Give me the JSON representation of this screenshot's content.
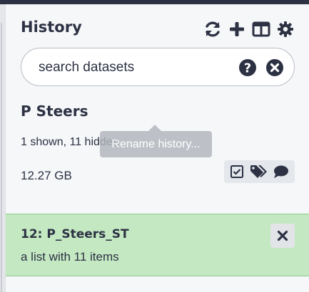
{
  "panel": {
    "title": "History"
  },
  "toolbar": {
    "icons": [
      "sync-icon",
      "plus-icon",
      "columns-icon",
      "gear-icon"
    ]
  },
  "search": {
    "placeholder": "search datasets"
  },
  "history": {
    "name": "P Steers",
    "counts": "1 shown, 11 hidden",
    "tooltip": "Rename history...",
    "size": "12.27 GB"
  },
  "items": [
    {
      "title": "12: P_Steers_ST",
      "subtitle": "a list with 11 items",
      "state_color": "#c4e8c2"
    }
  ],
  "colors": {
    "text": "#2c3143",
    "ok_state": "#c4e8c2"
  }
}
